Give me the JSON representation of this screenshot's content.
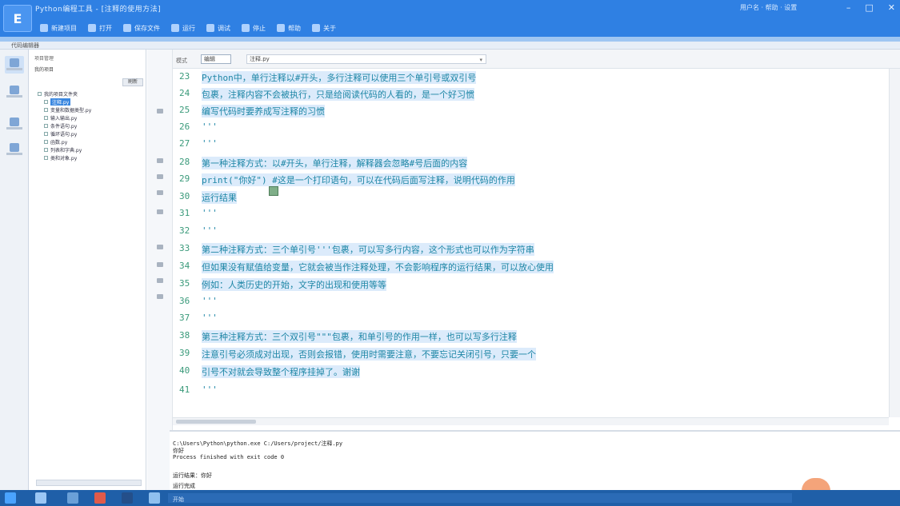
{
  "window": {
    "title": "Python编程工具 - [注释的使用方法]",
    "logo_glyph": "E",
    "user_info": "用户名 · 帮助 · 设置",
    "controls": [
      "–",
      "□",
      "✕"
    ]
  },
  "toolbar": {
    "buttons": [
      {
        "label": "新建项目",
        "icon": "new-project-icon"
      },
      {
        "label": "打开",
        "icon": "open-icon"
      },
      {
        "label": "保存文件",
        "icon": "save-icon"
      },
      {
        "label": "运行",
        "icon": "run-icon"
      },
      {
        "label": "调试",
        "icon": "debug-icon"
      },
      {
        "label": "停止",
        "icon": "stop-icon"
      },
      {
        "label": "帮助",
        "icon": "help-icon"
      },
      {
        "label": "关于",
        "icon": "about-icon"
      }
    ]
  },
  "tabbar": {
    "label": "代码编辑器"
  },
  "tree": {
    "header": "项目管理",
    "subheader": "我的项目",
    "button": "刷新",
    "items": [
      {
        "label": "我的项目文件夹"
      },
      {
        "label": "注释.py",
        "selected": true
      },
      {
        "label": "变量和数据类型.py"
      },
      {
        "label": "输入输出.py"
      },
      {
        "label": "条件语句.py"
      },
      {
        "label": "循环语句.py"
      },
      {
        "label": "函数.py"
      },
      {
        "label": "列表和字典.py"
      },
      {
        "label": "类和对象.py"
      }
    ]
  },
  "editor": {
    "mode_label": "模式",
    "mode_value": "编辑",
    "file_combo": "注释.py",
    "lines": [
      {
        "n": "23",
        "text": "Python中，单行注释以#开头，多行注释可以使用三个单引号或双引号",
        "hl": true
      },
      {
        "n": "24",
        "text": "包裹，注释内容不会被执行，只是给阅读代码的人看的，是一个好习惯",
        "hl": true
      },
      {
        "n": "25",
        "text": "编写代码时要养成写注释的习惯",
        "hl": true
      },
      {
        "n": "26",
        "text": "'''"
      },
      {
        "n": "27",
        "text": "'''"
      },
      {
        "n": "28",
        "text": "第一种注释方式：以#开头，单行注释，解释器会忽略#号后面的内容",
        "hl": true
      },
      {
        "n": "29",
        "text": "print(\"你好\") #这是一个打印语句，可以在代码后面写注释，说明代码的作用",
        "hl": true
      },
      {
        "n": "30",
        "text": "运行结果",
        "hl": true
      },
      {
        "n": "31",
        "text": "'''"
      },
      {
        "n": "32",
        "text": "'''"
      },
      {
        "n": "33",
        "text": "第二种注释方式：三个单引号'''包裹，可以写多行内容，这个形式也可以作为字符串",
        "hl": true
      },
      {
        "n": "34",
        "text": "但如果没有赋值给变量，它就会被当作注释处理，不会影响程序的运行结果，可以放心使用",
        "hl": true
      },
      {
        "n": "35",
        "text": "例如：人类历史的开始，文字的出现和使用等等",
        "hl": true
      },
      {
        "n": "36",
        "text": "'''"
      },
      {
        "n": "37",
        "text": "'''"
      },
      {
        "n": "38",
        "text": "第三种注释方式：三个双引号\"\"\"包裹，和单引号的作用一样，也可以写多行注释",
        "hl": true
      },
      {
        "n": "39",
        "text": "注意引号必须成对出现，否则会报错，使用时需要注意，不要忘记关闭引号，只要一个",
        "hl": true
      },
      {
        "n": "40",
        "text": "引号不对就会导致整个程序挂掉了。谢谢",
        "hl": true
      },
      {
        "n": "41",
        "text": "'''"
      }
    ]
  },
  "output": {
    "lines": [
      "C:\\Users\\Python\\python.exe C:/Users/project/注释.py",
      "你好",
      "Process finished with exit code 0",
      "",
      "运行结果：你好",
      "运行完成"
    ]
  },
  "taskbar": {
    "label": "开始"
  }
}
